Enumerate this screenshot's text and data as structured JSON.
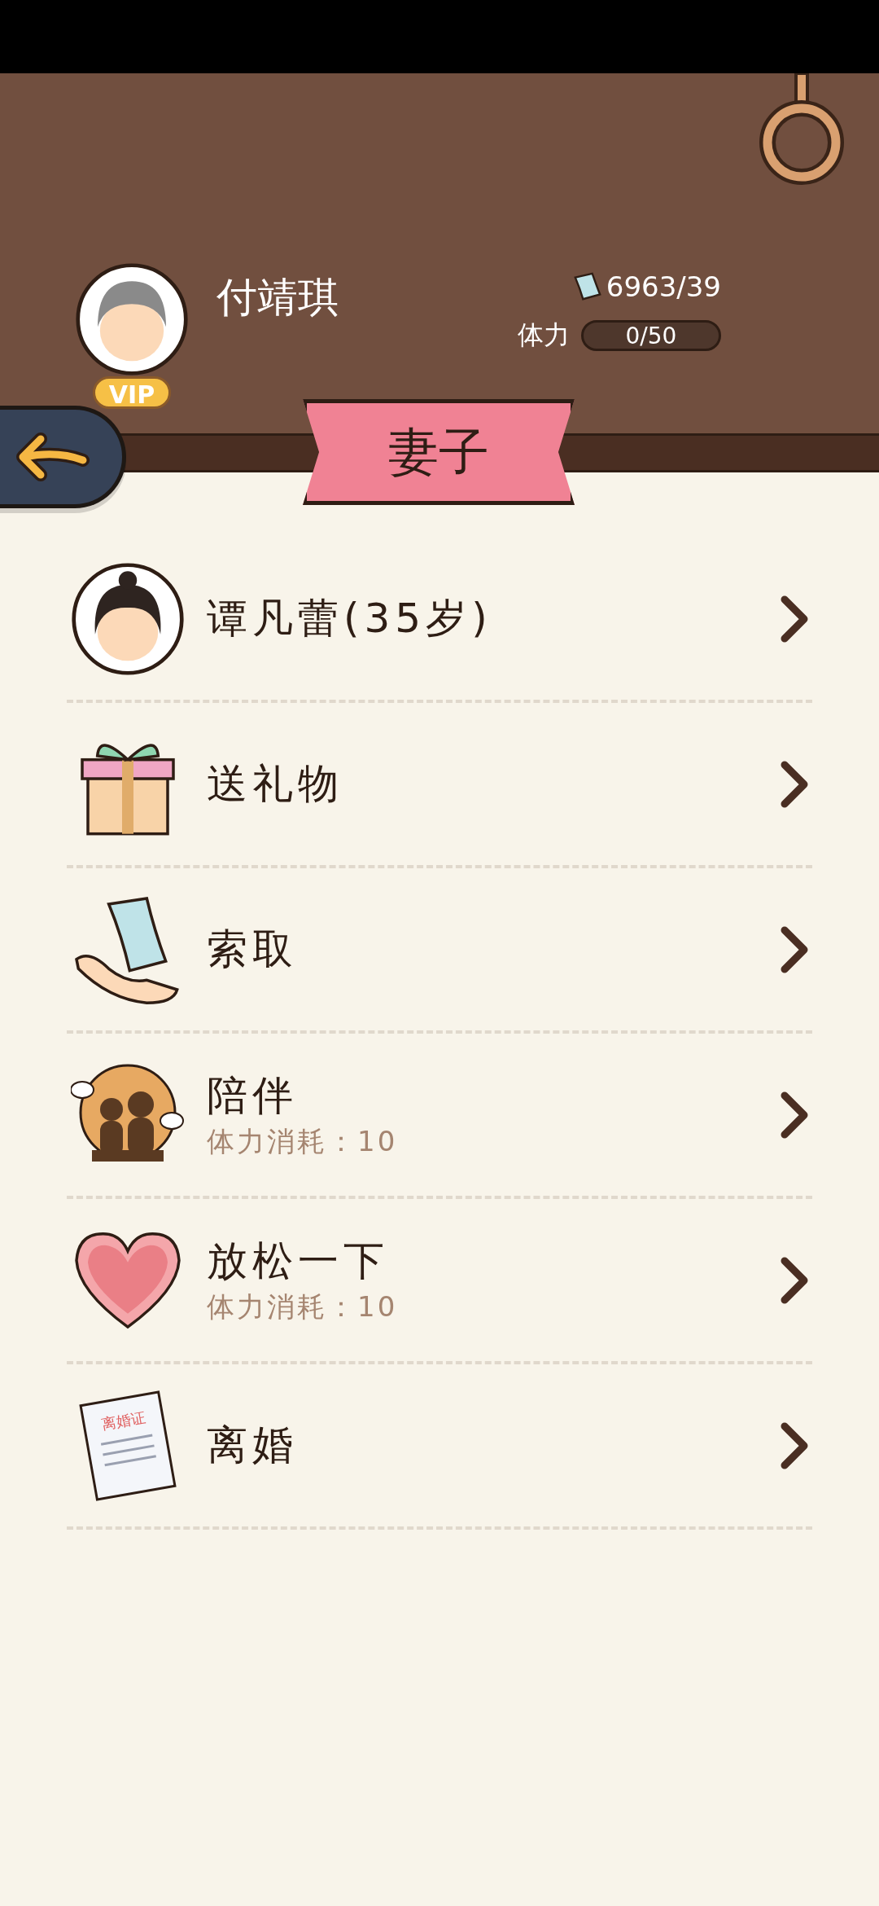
{
  "header": {
    "name": "付靖琪",
    "vip": "VIP",
    "money": "6963/39",
    "stamina_label": "体力",
    "stamina": "0/50"
  },
  "title": "妻子",
  "menu": [
    {
      "kind": "avatar",
      "label": "谭凡蕾(35岁)"
    },
    {
      "kind": "gift",
      "label": "送礼物"
    },
    {
      "kind": "money",
      "label": "索取"
    },
    {
      "kind": "companion",
      "label": "陪伴",
      "cost": "体力消耗：10"
    },
    {
      "kind": "heart",
      "label": "放松一下",
      "cost": "体力消耗：10"
    },
    {
      "kind": "certificate",
      "label": "离婚",
      "stamp": "离婚证"
    }
  ]
}
